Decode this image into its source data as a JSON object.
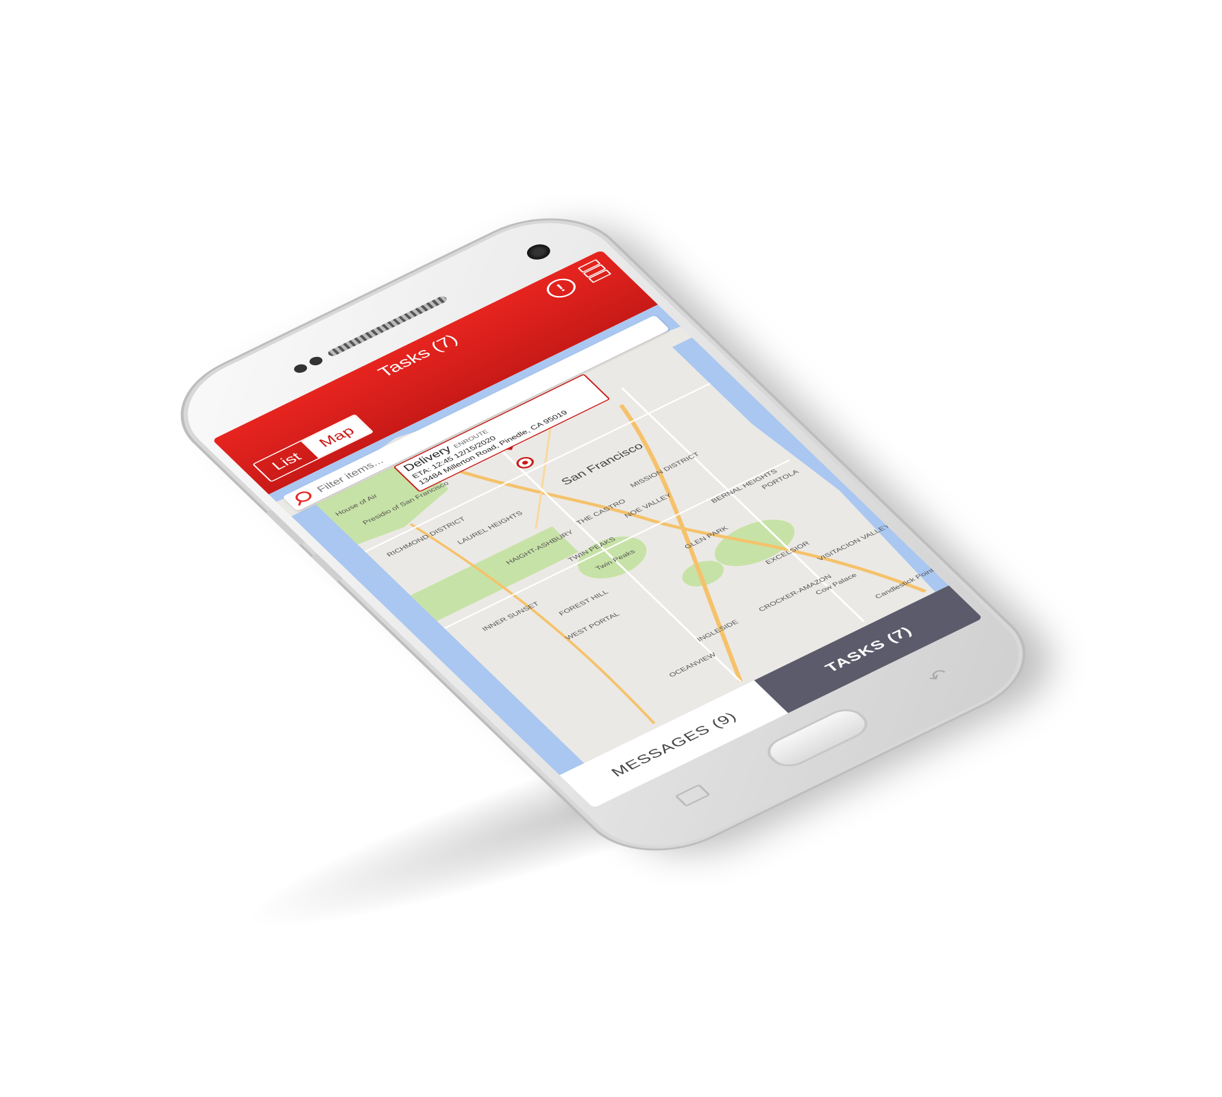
{
  "header": {
    "title": "Tasks (7)",
    "toggle": {
      "list_label": "List",
      "map_label": "Map",
      "selected": "Map"
    },
    "icons": [
      "alert-circle-icon",
      "grid-menu-icon"
    ]
  },
  "filter": {
    "placeholder": "Filter items..."
  },
  "map": {
    "city_label": "San Francisco",
    "callout": {
      "title": "Delivery",
      "status": "ENROUTE",
      "eta": "ETA: 12:45 12/15/2020",
      "address": "13484 Millerton Road, Pinedle, CA 95019"
    },
    "labels": [
      "RICHMOND DISTRICT",
      "INNER SUNSET",
      "TWIN PEAKS",
      "NOE VALLEY",
      "GLEN PARK",
      "BERNAL HEIGHTS",
      "PORTOLA",
      "EXCELSIOR",
      "VISITACION VALLEY",
      "FOREST HILL",
      "WEST PORTAL",
      "OCEANVIEW",
      "INGLESIDE",
      "CROCKER-AMAZON",
      "Cow Palace",
      "THE CASTRO",
      "MISSION DISTRICT",
      "HAIGHT-ASHBURY",
      "LAUREL HEIGHTS",
      "Presidio of San Francisco",
      "Twin Peaks",
      "Candlestick Point",
      "House of Air"
    ]
  },
  "bottom_tabs": {
    "messages": "MESSAGES (9)",
    "tasks": "TASKS (7)",
    "active": "tasks"
  },
  "colors": {
    "brand_red": "#e7241f",
    "tab_dark": "#5c5b6b",
    "map_water": "#a9c7f0",
    "map_park": "#c7e2a6",
    "map_road": "#f5c26b"
  }
}
